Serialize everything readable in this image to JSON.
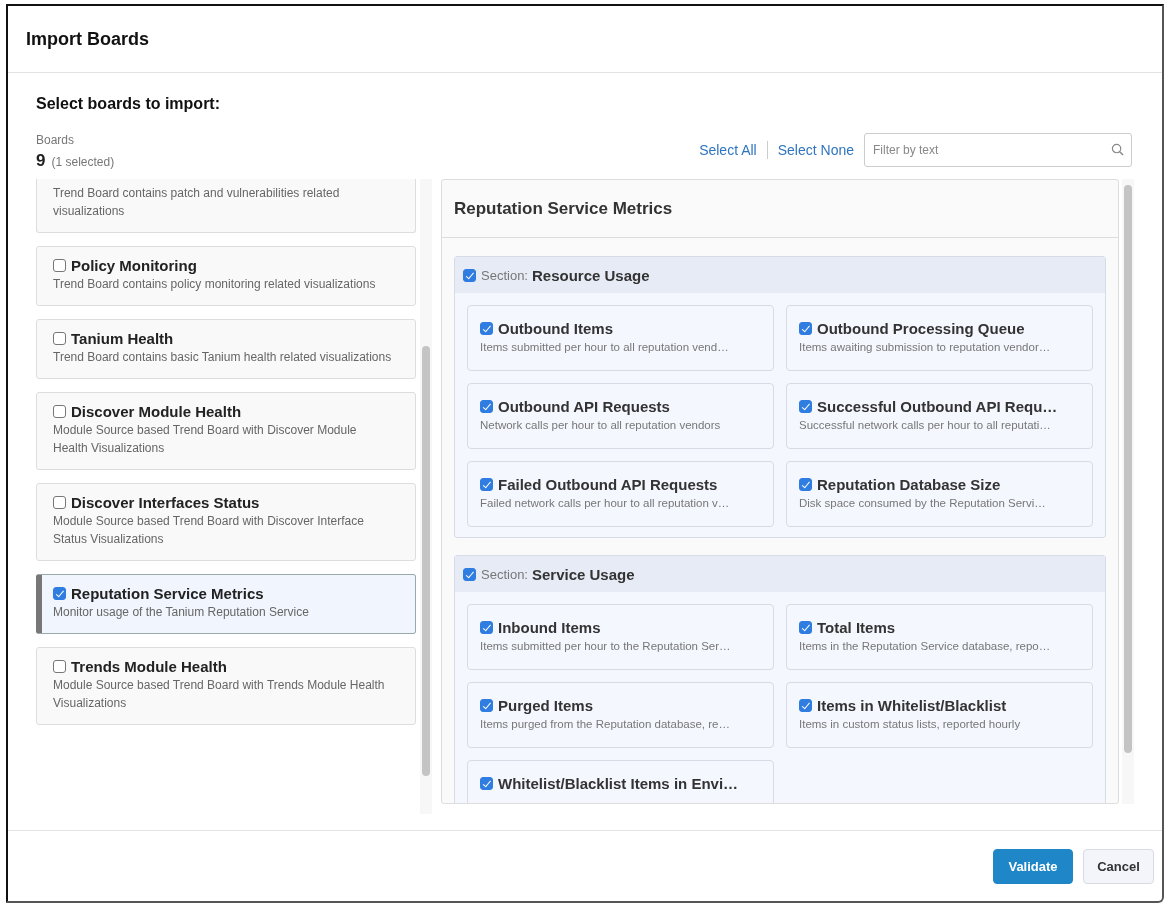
{
  "dialog": {
    "title": "Import Boards",
    "heading": "Select boards to import:"
  },
  "boards_summary": {
    "label": "Boards",
    "count": "9",
    "selected_text": "(1 selected)"
  },
  "boards": [
    {
      "description": "Trend Board contains patch and vulnerabilities related visualizations",
      "selected": false
    },
    {
      "title": "Policy Monitoring",
      "description": "Trend Board contains policy monitoring related visualizations",
      "checked": false,
      "selected": false
    },
    {
      "title": "Tanium Health",
      "description": "Trend Board contains basic Tanium health related visualizations",
      "checked": false,
      "selected": false
    },
    {
      "title": "Discover Module Health",
      "description": "Module Source based Trend Board with Discover Module Health Visualizations",
      "checked": false,
      "selected": false
    },
    {
      "title": "Discover Interfaces Status",
      "description": "Module Source based Trend Board with Discover Interface Status Visualizations",
      "checked": false,
      "selected": false
    },
    {
      "title": "Reputation Service Metrics",
      "description": "Monitor usage of the Tanium Reputation Service",
      "checked": true,
      "selected": true
    },
    {
      "title": "Trends Module Health",
      "description": "Module Source based Trend Board with Trends Module Health Visualizations",
      "checked": false,
      "selected": false
    }
  ],
  "toolbar": {
    "select_all": "Select All",
    "select_none": "Select None",
    "filter_placeholder": "Filter by text"
  },
  "detail": {
    "title": "Reputation Service Metrics",
    "sections": [
      {
        "prefix": "Section:",
        "name": "Resource Usage",
        "checked": true,
        "panels": [
          {
            "title": "Outbound Items",
            "description": "Items submitted per hour to all reputation vend…",
            "checked": true
          },
          {
            "title": "Outbound Processing Queue",
            "description": "Items awaiting submission to reputation vendor…",
            "checked": true
          },
          {
            "title": "Outbound API Requests",
            "description": "Network calls per hour to all reputation vendors",
            "checked": true
          },
          {
            "title": "Successful Outbound API Requ…",
            "description": "Successful network calls per hour to all reputati…",
            "checked": true
          },
          {
            "title": "Failed Outbound API Requests",
            "description": "Failed network calls per hour to all reputation v…",
            "checked": true
          },
          {
            "title": "Reputation Database Size",
            "description": "Disk space consumed by the Reputation Servi…",
            "checked": true
          }
        ]
      },
      {
        "prefix": "Section:",
        "name": "Service Usage",
        "checked": true,
        "panels": [
          {
            "title": "Inbound Items",
            "description": "Items submitted per hour to the Reputation Ser…",
            "checked": true
          },
          {
            "title": "Total Items",
            "description": "Items in the Reputation Service database, repo…",
            "checked": true
          },
          {
            "title": "Purged Items",
            "description": "Items purged from the Reputation database, re…",
            "checked": true
          },
          {
            "title": "Items in Whitelist/Blacklist",
            "description": "Items in custom status lists, reported hourly",
            "checked": true
          },
          {
            "title": "Whitelist/Blacklist Items in Envi…",
            "checked": true
          }
        ]
      }
    ]
  },
  "buttons": [
    {
      "label": "Validate",
      "kind": "primary"
    },
    {
      "label": "Cancel",
      "kind": "secondary"
    }
  ]
}
